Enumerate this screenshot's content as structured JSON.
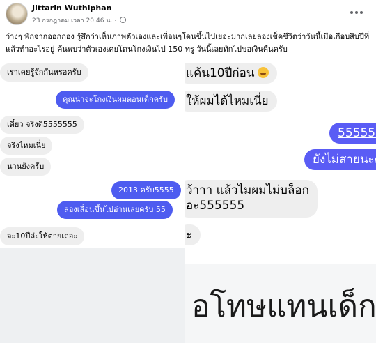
{
  "post": {
    "author": "Jittarin Wuthiphan",
    "timestamp": "23 กรกฎาคม เวลา 20:46 น. ·",
    "privacy_icon": "globe-icon",
    "text": "ว่างๆ พักจากออกกอง รู้สึกว่าเห็นภาพตัวเองและเพื่อนๆโดนขึ้นไปเยอะมากเลยลองเช็คชีวิตว่าวันนี้เมื่อเกือบสิบปีที่แล้วทำอะไรอยู่ ค้นพบว่าตัวเองเคยโดนโกงเงินไป 150 ทรู วันนี้เลยทักไปขอเงินคืนครับ"
  },
  "chat_left": {
    "messages": [
      {
        "side": "in",
        "text": "เราเคยรู้จักกันหรอครับ"
      },
      {
        "side": "out",
        "text": "คุณน่าจะโกงเงินผมตอนเด็กครับ"
      },
      {
        "side": "in",
        "text": "เดี๋ยว จริงดิ5555555"
      },
      {
        "side": "in",
        "text": "จริงไหมเนี่ย"
      },
      {
        "side": "in",
        "text": "นานยังครับ"
      },
      {
        "side": "out",
        "text": "2013 ครับ5555"
      },
      {
        "side": "out",
        "text": "ลองเลื่อนขึ้นไปอ่านเลยครับ 55"
      },
      {
        "side": "in",
        "text": "จะ10ปีล่ะให้ตายเถอะ"
      }
    ]
  },
  "chat_right": {
    "messages": [
      {
        "side": "in",
        "text": "แค้น10ปีก่อน"
      },
      {
        "side": "in",
        "text": "ให้ผมได้ไหมเนี่ย"
      },
      {
        "side": "out",
        "text": "555555"
      },
      {
        "side": "out",
        "text": "ยังไม่สายนะค"
      },
      {
        "side": "in",
        "text": "ว้าาา แล้วไมผมไม่บล็อก"
      },
      {
        "side": "in",
        "text": "อะ555555"
      },
      {
        "side": "in",
        "text": "ะ"
      }
    ],
    "emoji": "rofl-emoji"
  },
  "cropped_caption": "อโทษแทนเด็ก",
  "colors": {
    "outgoing_small": "#4e5cf0",
    "outgoing_large": "#5a5cf5",
    "incoming": "#eeeeee",
    "meta_text": "#65676b"
  }
}
